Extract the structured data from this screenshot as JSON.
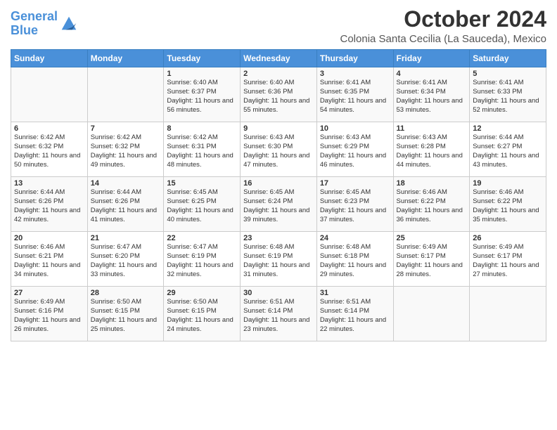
{
  "logo": {
    "line1": "General",
    "line2": "Blue"
  },
  "title": "October 2024",
  "subtitle": "Colonia Santa Cecilia (La Sauceda), Mexico",
  "days_of_week": [
    "Sunday",
    "Monday",
    "Tuesday",
    "Wednesday",
    "Thursday",
    "Friday",
    "Saturday"
  ],
  "weeks": [
    [
      {
        "day": "",
        "content": ""
      },
      {
        "day": "",
        "content": ""
      },
      {
        "day": "1",
        "content": "Sunrise: 6:40 AM\nSunset: 6:37 PM\nDaylight: 11 hours and 56 minutes."
      },
      {
        "day": "2",
        "content": "Sunrise: 6:40 AM\nSunset: 6:36 PM\nDaylight: 11 hours and 55 minutes."
      },
      {
        "day": "3",
        "content": "Sunrise: 6:41 AM\nSunset: 6:35 PM\nDaylight: 11 hours and 54 minutes."
      },
      {
        "day": "4",
        "content": "Sunrise: 6:41 AM\nSunset: 6:34 PM\nDaylight: 11 hours and 53 minutes."
      },
      {
        "day": "5",
        "content": "Sunrise: 6:41 AM\nSunset: 6:33 PM\nDaylight: 11 hours and 52 minutes."
      }
    ],
    [
      {
        "day": "6",
        "content": "Sunrise: 6:42 AM\nSunset: 6:32 PM\nDaylight: 11 hours and 50 minutes."
      },
      {
        "day": "7",
        "content": "Sunrise: 6:42 AM\nSunset: 6:32 PM\nDaylight: 11 hours and 49 minutes."
      },
      {
        "day": "8",
        "content": "Sunrise: 6:42 AM\nSunset: 6:31 PM\nDaylight: 11 hours and 48 minutes."
      },
      {
        "day": "9",
        "content": "Sunrise: 6:43 AM\nSunset: 6:30 PM\nDaylight: 11 hours and 47 minutes."
      },
      {
        "day": "10",
        "content": "Sunrise: 6:43 AM\nSunset: 6:29 PM\nDaylight: 11 hours and 46 minutes."
      },
      {
        "day": "11",
        "content": "Sunrise: 6:43 AM\nSunset: 6:28 PM\nDaylight: 11 hours and 44 minutes."
      },
      {
        "day": "12",
        "content": "Sunrise: 6:44 AM\nSunset: 6:27 PM\nDaylight: 11 hours and 43 minutes."
      }
    ],
    [
      {
        "day": "13",
        "content": "Sunrise: 6:44 AM\nSunset: 6:26 PM\nDaylight: 11 hours and 42 minutes."
      },
      {
        "day": "14",
        "content": "Sunrise: 6:44 AM\nSunset: 6:26 PM\nDaylight: 11 hours and 41 minutes."
      },
      {
        "day": "15",
        "content": "Sunrise: 6:45 AM\nSunset: 6:25 PM\nDaylight: 11 hours and 40 minutes."
      },
      {
        "day": "16",
        "content": "Sunrise: 6:45 AM\nSunset: 6:24 PM\nDaylight: 11 hours and 39 minutes."
      },
      {
        "day": "17",
        "content": "Sunrise: 6:45 AM\nSunset: 6:23 PM\nDaylight: 11 hours and 37 minutes."
      },
      {
        "day": "18",
        "content": "Sunrise: 6:46 AM\nSunset: 6:22 PM\nDaylight: 11 hours and 36 minutes."
      },
      {
        "day": "19",
        "content": "Sunrise: 6:46 AM\nSunset: 6:22 PM\nDaylight: 11 hours and 35 minutes."
      }
    ],
    [
      {
        "day": "20",
        "content": "Sunrise: 6:46 AM\nSunset: 6:21 PM\nDaylight: 11 hours and 34 minutes."
      },
      {
        "day": "21",
        "content": "Sunrise: 6:47 AM\nSunset: 6:20 PM\nDaylight: 11 hours and 33 minutes."
      },
      {
        "day": "22",
        "content": "Sunrise: 6:47 AM\nSunset: 6:19 PM\nDaylight: 11 hours and 32 minutes."
      },
      {
        "day": "23",
        "content": "Sunrise: 6:48 AM\nSunset: 6:19 PM\nDaylight: 11 hours and 31 minutes."
      },
      {
        "day": "24",
        "content": "Sunrise: 6:48 AM\nSunset: 6:18 PM\nDaylight: 11 hours and 29 minutes."
      },
      {
        "day": "25",
        "content": "Sunrise: 6:49 AM\nSunset: 6:17 PM\nDaylight: 11 hours and 28 minutes."
      },
      {
        "day": "26",
        "content": "Sunrise: 6:49 AM\nSunset: 6:17 PM\nDaylight: 11 hours and 27 minutes."
      }
    ],
    [
      {
        "day": "27",
        "content": "Sunrise: 6:49 AM\nSunset: 6:16 PM\nDaylight: 11 hours and 26 minutes."
      },
      {
        "day": "28",
        "content": "Sunrise: 6:50 AM\nSunset: 6:15 PM\nDaylight: 11 hours and 25 minutes."
      },
      {
        "day": "29",
        "content": "Sunrise: 6:50 AM\nSunset: 6:15 PM\nDaylight: 11 hours and 24 minutes."
      },
      {
        "day": "30",
        "content": "Sunrise: 6:51 AM\nSunset: 6:14 PM\nDaylight: 11 hours and 23 minutes."
      },
      {
        "day": "31",
        "content": "Sunrise: 6:51 AM\nSunset: 6:14 PM\nDaylight: 11 hours and 22 minutes."
      },
      {
        "day": "",
        "content": ""
      },
      {
        "day": "",
        "content": ""
      }
    ]
  ]
}
